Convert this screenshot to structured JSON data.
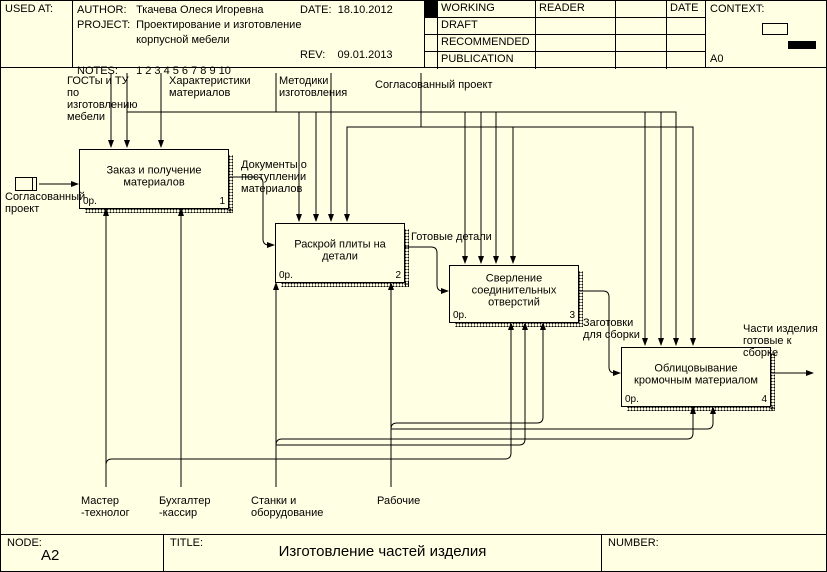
{
  "header": {
    "used_at_label": "USED AT:",
    "author_label": "AUTHOR:",
    "author": "Ткачева Олеся Игоревна",
    "project_label": "PROJECT:",
    "project": "Проектирование и изготовление корпусной мебели",
    "notes_label": "NOTES:",
    "notes": "1  2  3  4  5  6  7  8  9  10",
    "date_label": "DATE:",
    "date": "18.10.2012",
    "rev_label": "REV:",
    "rev": "09.01.2013",
    "status": {
      "working": "WORKING",
      "draft": "DRAFT",
      "recommended": "RECOMMENDED",
      "publication": "PUBLICATION",
      "reader": "READER",
      "date": "DATE"
    },
    "context_label": "CONTEXT:",
    "a0": "A0"
  },
  "footer": {
    "node_label": "NODE:",
    "node": "A2",
    "title_label": "TITLE:",
    "title": "Изготовление частей изделия",
    "number_label": "NUMBER:"
  },
  "activities": {
    "a1": {
      "name": "Заказ и получение материалов",
      "cost": "0р.",
      "num": "1"
    },
    "a2": {
      "name": "Раскрой плиты на детали",
      "cost": "0р.",
      "num": "2"
    },
    "a3": {
      "name": "Сверление соединительных отверстий",
      "cost": "0р.",
      "num": "3"
    },
    "a4": {
      "name": "Облицовывание кромочным материалом",
      "cost": "0р.",
      "num": "4"
    }
  },
  "labels": {
    "in1": "Согласованный проект",
    "c1": "ГОСТы и ТУ по изготовлению мебели",
    "c2": "Характеристики материалов",
    "c3": "Методики изготовления",
    "c4": "Согласованный проект",
    "d1": "Документы о поступлении материалов",
    "o2": "Готовые детали",
    "o3": "Заготовки для сборки",
    "out": "Части изделия готовые к сборке",
    "m1": "Мастер -технолог",
    "m2": "Бухгалтер -кассир",
    "m3": "Станки и оборудование",
    "m4": "Рабочие"
  }
}
